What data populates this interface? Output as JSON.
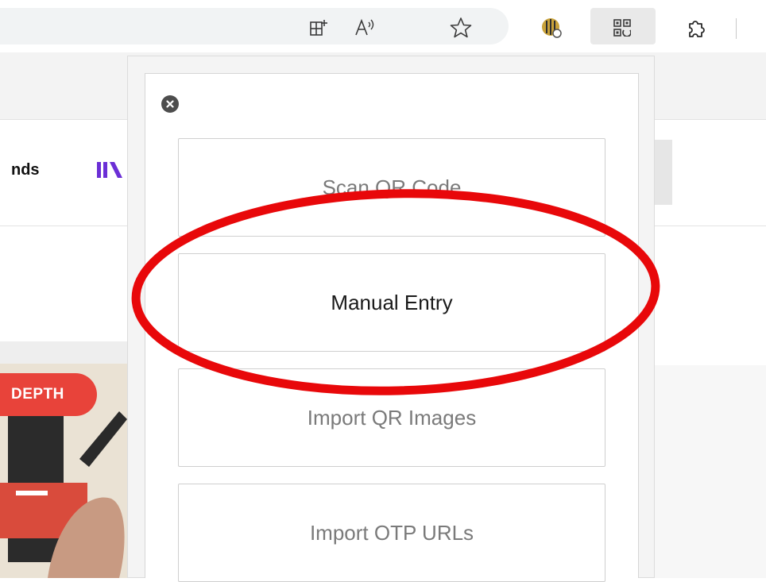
{
  "toolbar": {
    "icons": [
      {
        "name": "add-tab-icon",
        "glyph": "⊞"
      },
      {
        "name": "read-aloud-icon",
        "glyph": "A"
      },
      {
        "name": "favorite-star-icon",
        "glyph": "☆"
      },
      {
        "name": "extension-icon",
        "glyph": "●"
      },
      {
        "name": "qr-authenticator-icon",
        "glyph": "▦"
      },
      {
        "name": "extensions-puzzle-icon",
        "glyph": "⚙"
      }
    ]
  },
  "page": {
    "nav_text": "nds",
    "badge": "DEPTH"
  },
  "popup": {
    "buttons": [
      {
        "label": "Scan QR Code"
      },
      {
        "label": "Manual Entry"
      },
      {
        "label": "Import QR Images"
      },
      {
        "label": "Import OTP URLs"
      }
    ]
  },
  "colors": {
    "annotation": "#e8080a",
    "badge": "#e8433a",
    "logo": "#6b2fd6"
  }
}
